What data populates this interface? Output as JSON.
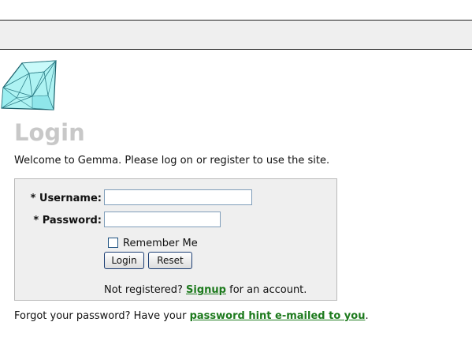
{
  "header": {
    "title": "Login"
  },
  "welcome_text": "Welcome to Gemma. Please log on or register to use the site.",
  "login_form": {
    "username_label": "* Username:",
    "username_value": "",
    "password_label": "* Password:",
    "password_value": "",
    "remember_me_label": "Remember Me",
    "remember_me_checked": false,
    "login_button": "Login",
    "reset_button": "Reset",
    "signup_prefix": "Not registered?",
    "signup_link": "Signup",
    "signup_suffix": "for an account."
  },
  "forgot": {
    "prefix": "Forgot your password? Have your",
    "link": "password hint e-mailed to you",
    "suffix": "."
  },
  "icons": {
    "logo": "gem-diamond-icon"
  },
  "colors": {
    "title": "#c8c8c8",
    "link": "#1d7a1d",
    "panel_background": "#efefef",
    "header_bar": "#efefef"
  }
}
